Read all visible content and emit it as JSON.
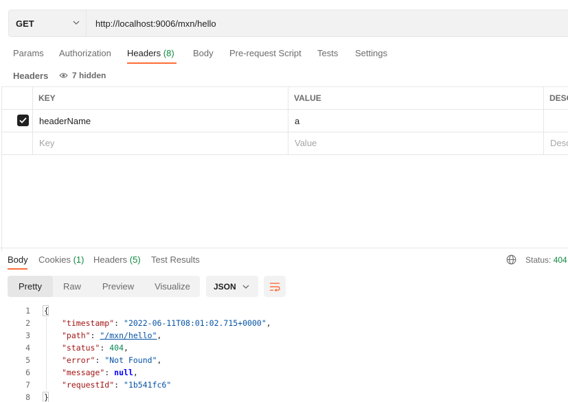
{
  "request": {
    "method": "GET",
    "url": "http://localhost:9006/mxn/hello"
  },
  "tabs": [
    {
      "label": "Params",
      "count": ""
    },
    {
      "label": "Authorization",
      "count": ""
    },
    {
      "label": "Headers",
      "count": "(8)"
    },
    {
      "label": "Body",
      "count": ""
    },
    {
      "label": "Pre-request Script",
      "count": ""
    },
    {
      "label": "Tests",
      "count": ""
    },
    {
      "label": "Settings",
      "count": ""
    }
  ],
  "headers_section": {
    "title": "Headers",
    "hidden_label": "7 hidden",
    "columns": [
      "KEY",
      "VALUE",
      "DESC"
    ],
    "rows": [
      {
        "checked": true,
        "key": "headerName",
        "value": "a"
      }
    ],
    "placeholder": {
      "key": "Key",
      "value": "Value",
      "desc": "Desc"
    }
  },
  "response": {
    "tabs": [
      {
        "label": "Body",
        "count": ""
      },
      {
        "label": "Cookies",
        "count": "(1)"
      },
      {
        "label": "Headers",
        "count": "(5)"
      },
      {
        "label": "Test Results",
        "count": ""
      }
    ],
    "status_label": "Status:",
    "status_code": "404",
    "view_modes": [
      "Pretty",
      "Raw",
      "Preview",
      "Visualize"
    ],
    "active_view": "Pretty",
    "format": "JSON",
    "body_lines": [
      {
        "num": "1",
        "indent": "",
        "key": "",
        "val": "",
        "raw": "{"
      },
      {
        "num": "2",
        "key": "\"timestamp\"",
        "val": "\"2022-06-11T08:01:02.715+0000\"",
        "type": "s",
        "comma": ","
      },
      {
        "num": "3",
        "key": "\"path\"",
        "val": "\"/mxn/hello\"",
        "type": "s",
        "comma": ","
      },
      {
        "num": "4",
        "key": "\"status\"",
        "val": "404",
        "type": "n",
        "comma": ","
      },
      {
        "num": "5",
        "key": "\"error\"",
        "val": "\"Not Found\"",
        "type": "s",
        "comma": ","
      },
      {
        "num": "6",
        "key": "\"message\"",
        "val": "null",
        "type": "b",
        "comma": ","
      },
      {
        "num": "7",
        "key": "\"requestId\"",
        "val": "\"1b541fc6\"",
        "type": "s",
        "comma": ""
      },
      {
        "num": "8",
        "indent": "",
        "key": "",
        "val": "",
        "raw": "}"
      }
    ]
  },
  "colors": {
    "accent": "#ff6c37",
    "count_green": "#0e8a3e"
  }
}
